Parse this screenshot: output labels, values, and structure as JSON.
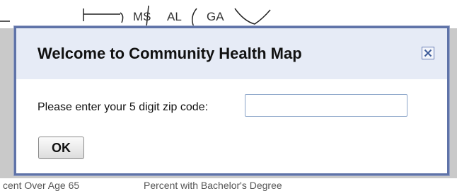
{
  "map": {
    "state_labels": [
      "MS",
      "AL",
      "GA"
    ],
    "below_labels": [
      "cent Over Age 65",
      "Percent with Bachelor's Degree"
    ]
  },
  "dialog": {
    "title": "Welcome to Community Health Map",
    "close_icon": "close-icon",
    "zip_label": "Please enter your 5 digit zip code:",
    "zip_value": "",
    "zip_placeholder": "",
    "ok_label": "OK"
  },
  "colors": {
    "dialog_border": "#5f73a8",
    "header_bg": "#e6ebf6",
    "map_bg": "#c9c9c9"
  }
}
